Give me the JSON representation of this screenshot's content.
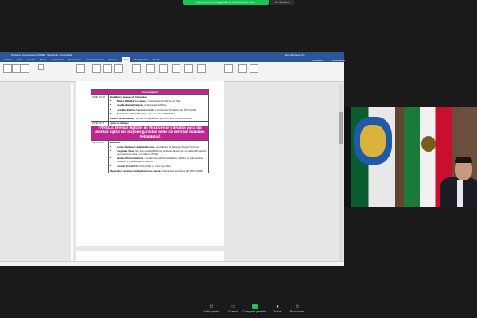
{
  "zoom": {
    "share_banner": "Usted está viendo la pantalla de José Montalvo Vira...",
    "options_label": "Ver Opciones",
    "bottom_bar": [
      {
        "icon": "participants-icon",
        "label": "Participantes",
        "glyph": "⚇"
      },
      {
        "icon": "chat-icon",
        "label": "Chatear",
        "glyph": "▭"
      },
      {
        "icon": "share-screen-icon",
        "label": "Compartir pantalla",
        "glyph": "↑"
      },
      {
        "icon": "record-icon",
        "label": "Grabar",
        "glyph": "●"
      },
      {
        "icon": "reactions-icon",
        "label": "Reacciones",
        "glyph": "☺"
      }
    ]
  },
  "word": {
    "title": "Programa Conversatorio PANEL, (Versión 1) - Compatible",
    "user": "José Montalvo Vira",
    "tabs": [
      "Archivo",
      "Inicio",
      "Insertar",
      "Diseño",
      "Disposición",
      "Referencias",
      "Correspondencia",
      "Revisar",
      "Vista",
      "Programador",
      "Ayuda"
    ],
    "active_tab": "Vista",
    "share_label": "Compartir",
    "comments_label": "Comentarios"
  },
  "program": {
    "acto_title": "Acto Inaugural",
    "acto_time": "10:00 -10:30",
    "acto_intro": "Presidium y mensaje de bienvenida.",
    "acto_people": [
      {
        "name": "Blanca Lilia Ibarra Cadena",
        "role": ", Comisionada Presidenta del INAI."
      },
      {
        "name": "Josefina Román Vergara",
        "role": ", Comisionada del INAI."
      },
      {
        "name": "Arístides Rodrigo Guerrero García",
        "role": ", Comisionado Presidente del INFOCDMX."
      },
      {
        "name": "Luis Gustavo Parra Noriega",
        "role": ", Comisionado del INFOEM."
      }
    ],
    "acto_host_label": "Maestro de ceremonias:",
    "acto_host_text": " Voz de la Transparencia y la Privacidad del INFOCDMX.",
    "break_time": "10:30-10:35",
    "break_text": "Ajuste de tiempos",
    "panel_time": "10:35-11:50",
    "panel_title": "PANEL I: Brechas digitales en México retos y desafíos para una sociedad digital con mayores garantías sobre sus derechos humanos. (64 minutos)",
    "panelists_label": "Panelistas:",
    "panelists": [
      {
        "name": "Carlos Emiliano Calderón Mercado",
        "role": ", Coordinador de Estrategia Digital Nacional."
      },
      {
        "name": "Alejandro Nassi",
        "role": ", Jefe Área Gestión Pública y Gobierno Abierto de la Comisión Económica para América Latina y el Caribe (CEPAL)."
      },
      {
        "name": "Glenda Michel Gutiérrez",
        "role": ", Coordinadora de Emprendimiento Público de la Escuela de Gobierno y Transformación Pública."
      },
      {
        "name": "AnaIsly BravoISOL",
        "role": ", Especialista en Ciberseguridad."
      }
    ],
    "moderator_label": "Moderador: Arístides Rodrigo Guerrero García",
    "moderator_text": ", Comisionado Presidente del INFOCDMX."
  },
  "colors": {
    "accent": "#c0268f",
    "zoom_green": "#19c35a",
    "word_blue": "#2b579a"
  }
}
